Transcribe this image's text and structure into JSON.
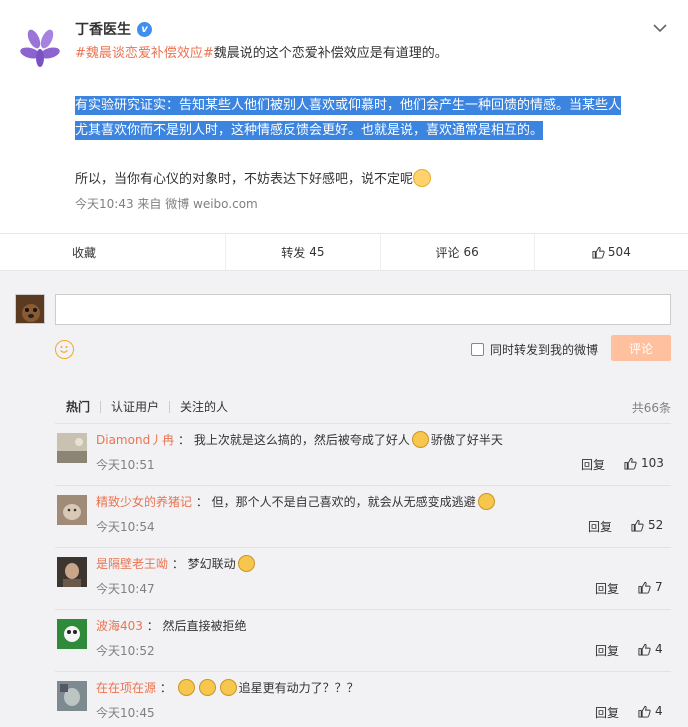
{
  "post": {
    "author": "丁香医生",
    "verified_mark": "v",
    "hashtag": "#魏晨谈恋爱补偿效应#",
    "line1_rest": "魏晨说的这个恋爱补偿效应是有道理的。",
    "highlight_1": "有实验研究证实：告知某些人他们被别人喜欢或仰慕时，他们会产生一种回馈的情感。当某些人",
    "highlight_2": "尤其喜欢你而不是别人时，这种情感反馈会更好。也就是说，喜欢通常是相互的。",
    "line3": "所以，当你有心仪的对象时，不妨表达下好感吧，说不定呢",
    "meta": "今天10:43  来自 微博 weibo.com"
  },
  "actions": {
    "favorite": "收藏",
    "repost": "转发",
    "repost_count": "45",
    "comment": "评论",
    "comment_count": "66",
    "like_count": "504"
  },
  "composer": {
    "forward_label": "同时转发到我的微博",
    "submit_label": "评论"
  },
  "tabs": {
    "items": [
      "热门",
      "认证用户",
      "关注的人"
    ],
    "total": "共66条"
  },
  "comments": [
    {
      "name": "Diamond丿冉",
      "text_a": "我上次就是这么搞的，然后被夸成了好人",
      "text_b": "骄傲了好半天",
      "time": "今天10:51",
      "reply": "回复",
      "likes": "103"
    },
    {
      "name": "精致少女的养猪记",
      "text_a": "但，那个人不是自己喜欢的，就会从无感变成逃避",
      "text_b": "",
      "time": "今天10:54",
      "reply": "回复",
      "likes": "52"
    },
    {
      "name": "是隔壁老王呦",
      "text_a": "梦幻联动",
      "text_b": "",
      "time": "今天10:47",
      "reply": "回复",
      "likes": "7"
    },
    {
      "name": "波海403",
      "text_a": "然后直接被拒绝",
      "text_b": "",
      "time": "今天10:52",
      "reply": "回复",
      "likes": "4"
    },
    {
      "name": "在在项在源",
      "text_a": "",
      "text_b": "追星更有动力了？？？",
      "time": "今天10:45",
      "reply": "回复",
      "likes": "4"
    }
  ],
  "colors": {
    "accent": "#eb7350",
    "selection": "#3b84e0",
    "verified": "#3f8ff1",
    "submit_disabled": "#ffc09f"
  }
}
